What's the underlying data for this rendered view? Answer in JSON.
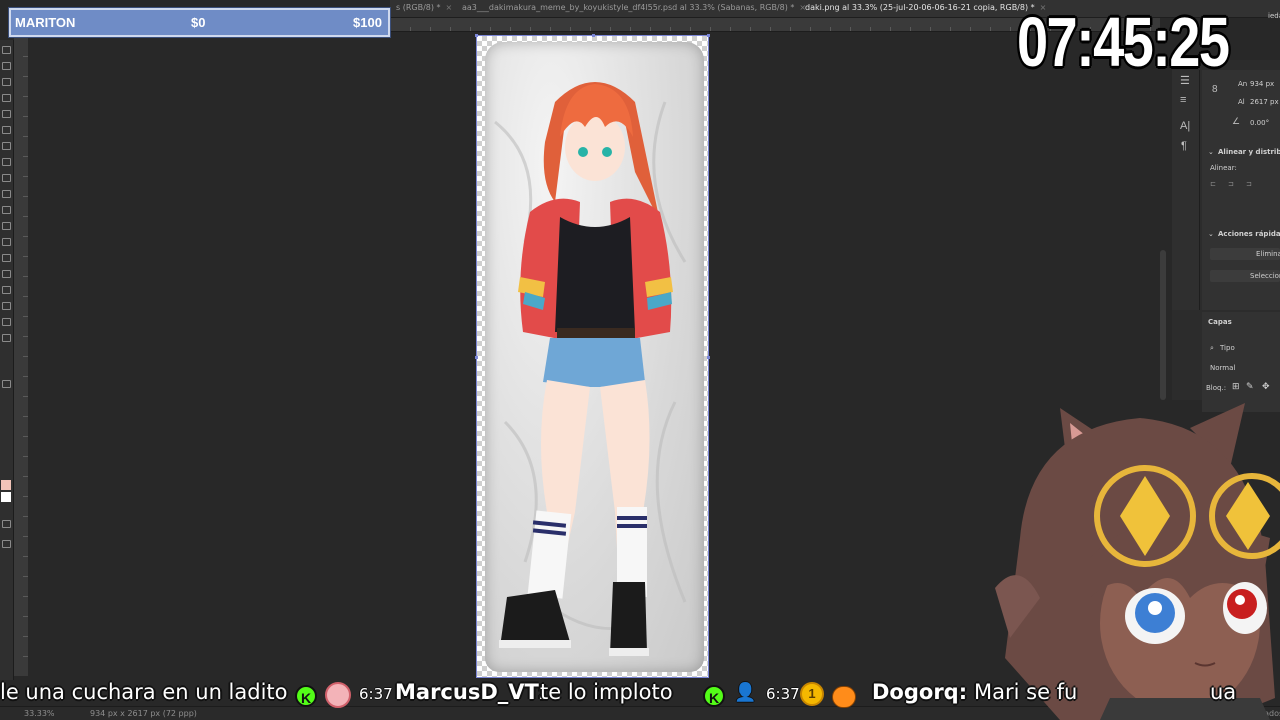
{
  "overlay": {
    "goal_name": "MARITON",
    "goal_current": "$0",
    "goal_target": "$100",
    "clock": "07:45:25"
  },
  "tabs": [
    {
      "label": "s (RGB/8) *",
      "active": false
    },
    {
      "label": "aa3___dakimakura_meme_by_koyukistyle_df4l55r.psd al 33.3% (Sabanas, RGB/8) *",
      "active": false
    },
    {
      "label": "daki.png al 33.3% (25-jul-20-06-06-16-21 copia, RGB/8) *",
      "active": true
    }
  ],
  "properties_panel": {
    "width_label": "An",
    "width_value": "934 px",
    "height_label": "Al",
    "height_value": "2617 px",
    "angle_value": "0.00°",
    "align_title": "Alinear y distribu",
    "align_sub": "Alinear:",
    "quick_actions_title": "Acciones rápidas",
    "quick_action_1": "Eliminar",
    "quick_action_2": "Seleccion",
    "top_label": "ieda"
  },
  "layers_panel": {
    "title": "Capas",
    "filter_label": "Tipo",
    "blend_mode": "Normal",
    "lock_label": "Bloq.:"
  },
  "statusbar": {
    "zoom": "33.33%",
    "doc_info": "934 px x 2617 px (72 ppp)",
    "right_label": "Trazados"
  },
  "chat": {
    "msg1_text": "le una cuchara en un ladito",
    "msg2_time": "6:37",
    "msg2_user": "MarcusD_VT:",
    "msg2_text": "te lo imploto",
    "msg3_time": "6:37",
    "msg3_badge": "1",
    "msg3_user": "Dogorq:",
    "msg3_text": "Mari se fu",
    "msg3_tail": "ua",
    "kick_icon": "K"
  },
  "colors": {
    "goal_bar": "#6f8cc6",
    "kick_green": "#53fc18",
    "selection_blue": "#7b86d6"
  }
}
